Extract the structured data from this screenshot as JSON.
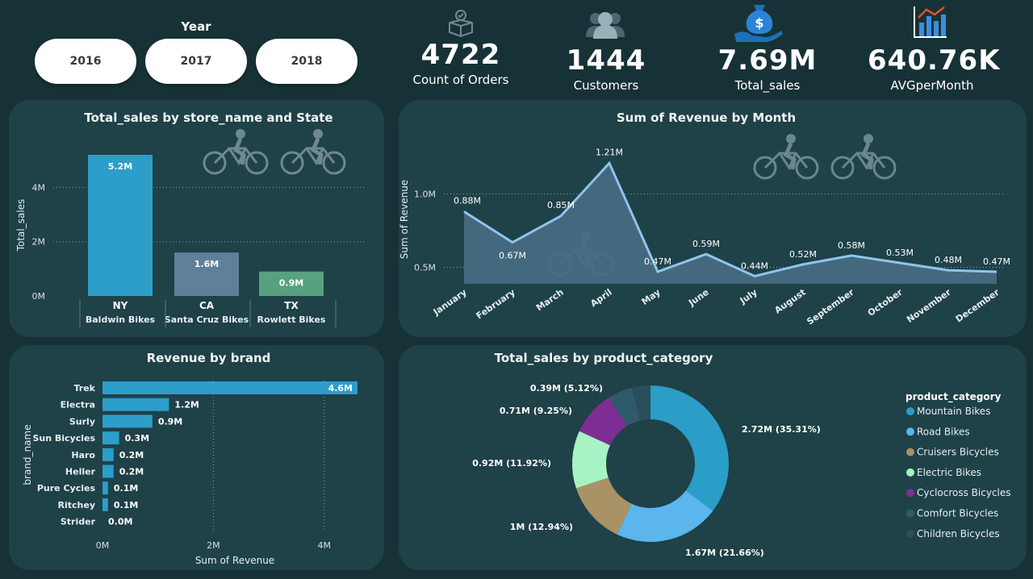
{
  "slicer": {
    "title": "Year",
    "options": [
      "2016",
      "2017",
      "2018"
    ]
  },
  "kpis": [
    {
      "value": "4722",
      "label": "Count of Orders",
      "icon": "package-icon"
    },
    {
      "value": "1444",
      "label": "Customers",
      "icon": "customers-icon"
    },
    {
      "value": "7.69M",
      "label": "Total_sales",
      "icon": "money-bag-icon"
    },
    {
      "value": "640.76K",
      "label": "AVGperMonth",
      "icon": "bar-chart-icon"
    }
  ],
  "colors": {
    "background": "#173236",
    "card": "#1f4148",
    "bar_ny": "#2c9ec9",
    "bar_ca": "#5f8098",
    "bar_tx": "#57a17e",
    "brand_bar": "#2c9ec9",
    "area_line": "#8ec5ec",
    "area_fill": "#486d83"
  },
  "chart_data": [
    {
      "type": "bar",
      "title": "Total_sales by store_name and State",
      "ylabel": "Total_sales",
      "xlabel": "",
      "categories": [
        "NY",
        "CA",
        "TX"
      ],
      "subcategories": [
        "Baldwin Bikes",
        "Santa Cruz Bikes",
        "Rowlett Bikes"
      ],
      "values": [
        5.2,
        1.6,
        0.9
      ],
      "data_labels": [
        "5.2M",
        "1.6M",
        "0.9M"
      ],
      "yticks": [
        "0M",
        "2M",
        "4M"
      ],
      "ylim": [
        0,
        5.2
      ],
      "grid": true
    },
    {
      "type": "area",
      "title": "Sum of Revenue by Month",
      "ylabel": "Sum of Revenue",
      "xlabel": "",
      "categories": [
        "January",
        "February",
        "March",
        "April",
        "May",
        "June",
        "July",
        "August",
        "September",
        "October",
        "November",
        "December"
      ],
      "values": [
        0.88,
        0.67,
        0.85,
        1.21,
        0.47,
        0.59,
        0.44,
        0.52,
        0.58,
        0.53,
        0.48,
        0.47
      ],
      "data_labels": [
        "0.88M",
        "0.67M",
        "0.85M",
        "1.21M",
        "0.47M",
        "0.59M",
        "0.44M",
        "0.52M",
        "0.58M",
        "0.53M",
        "0.48M",
        "0.47M"
      ],
      "yticks": [
        "0.5M",
        "1.0M"
      ],
      "ylim": [
        0.5,
        1.21
      ],
      "grid": true
    },
    {
      "type": "bar",
      "orientation": "horizontal",
      "title": "Revenue by brand",
      "ylabel": "brand_name",
      "xlabel": "Sum of Revenue",
      "categories": [
        "Trek",
        "Electra",
        "Surly",
        "Sun Bicycles",
        "Haro",
        "Heller",
        "Pure Cycles",
        "Ritchey",
        "Strider"
      ],
      "values": [
        4.6,
        1.2,
        0.9,
        0.3,
        0.2,
        0.2,
        0.1,
        0.1,
        0.0
      ],
      "data_labels": [
        "4.6M",
        "1.2M",
        "0.9M",
        "0.3M",
        "0.2M",
        "0.2M",
        "0.1M",
        "0.1M",
        "0.0M"
      ],
      "xticks": [
        "0M",
        "2M",
        "4M"
      ],
      "xlim": [
        0,
        4.6
      ],
      "grid": true
    },
    {
      "type": "pie",
      "donut": true,
      "title": "Total_sales by product_category",
      "legend_title": "product_category",
      "legend_position": "right",
      "categories": [
        "Mountain Bikes",
        "Road Bikes",
        "Cruisers Bicycles",
        "Electric Bikes",
        "Cyclocross Bicycles",
        "Comfort Bicycles",
        "Children Bicycles"
      ],
      "values": [
        35.31,
        21.66,
        12.94,
        11.92,
        9.25,
        5.12,
        3.8
      ],
      "data_labels": [
        "2.72M (35.31%)",
        "1.67M (21.66%)",
        "1M (12.94%)",
        "0.92M (11.92%)",
        "0.71M (9.25%)",
        "0.39M (5.12%)",
        ""
      ],
      "colors": [
        "#2b9dc6",
        "#5ab6ec",
        "#a89266",
        "#a7f3c4",
        "#7e2d95",
        "#2f5a6c",
        "#2a4e5a"
      ]
    }
  ]
}
